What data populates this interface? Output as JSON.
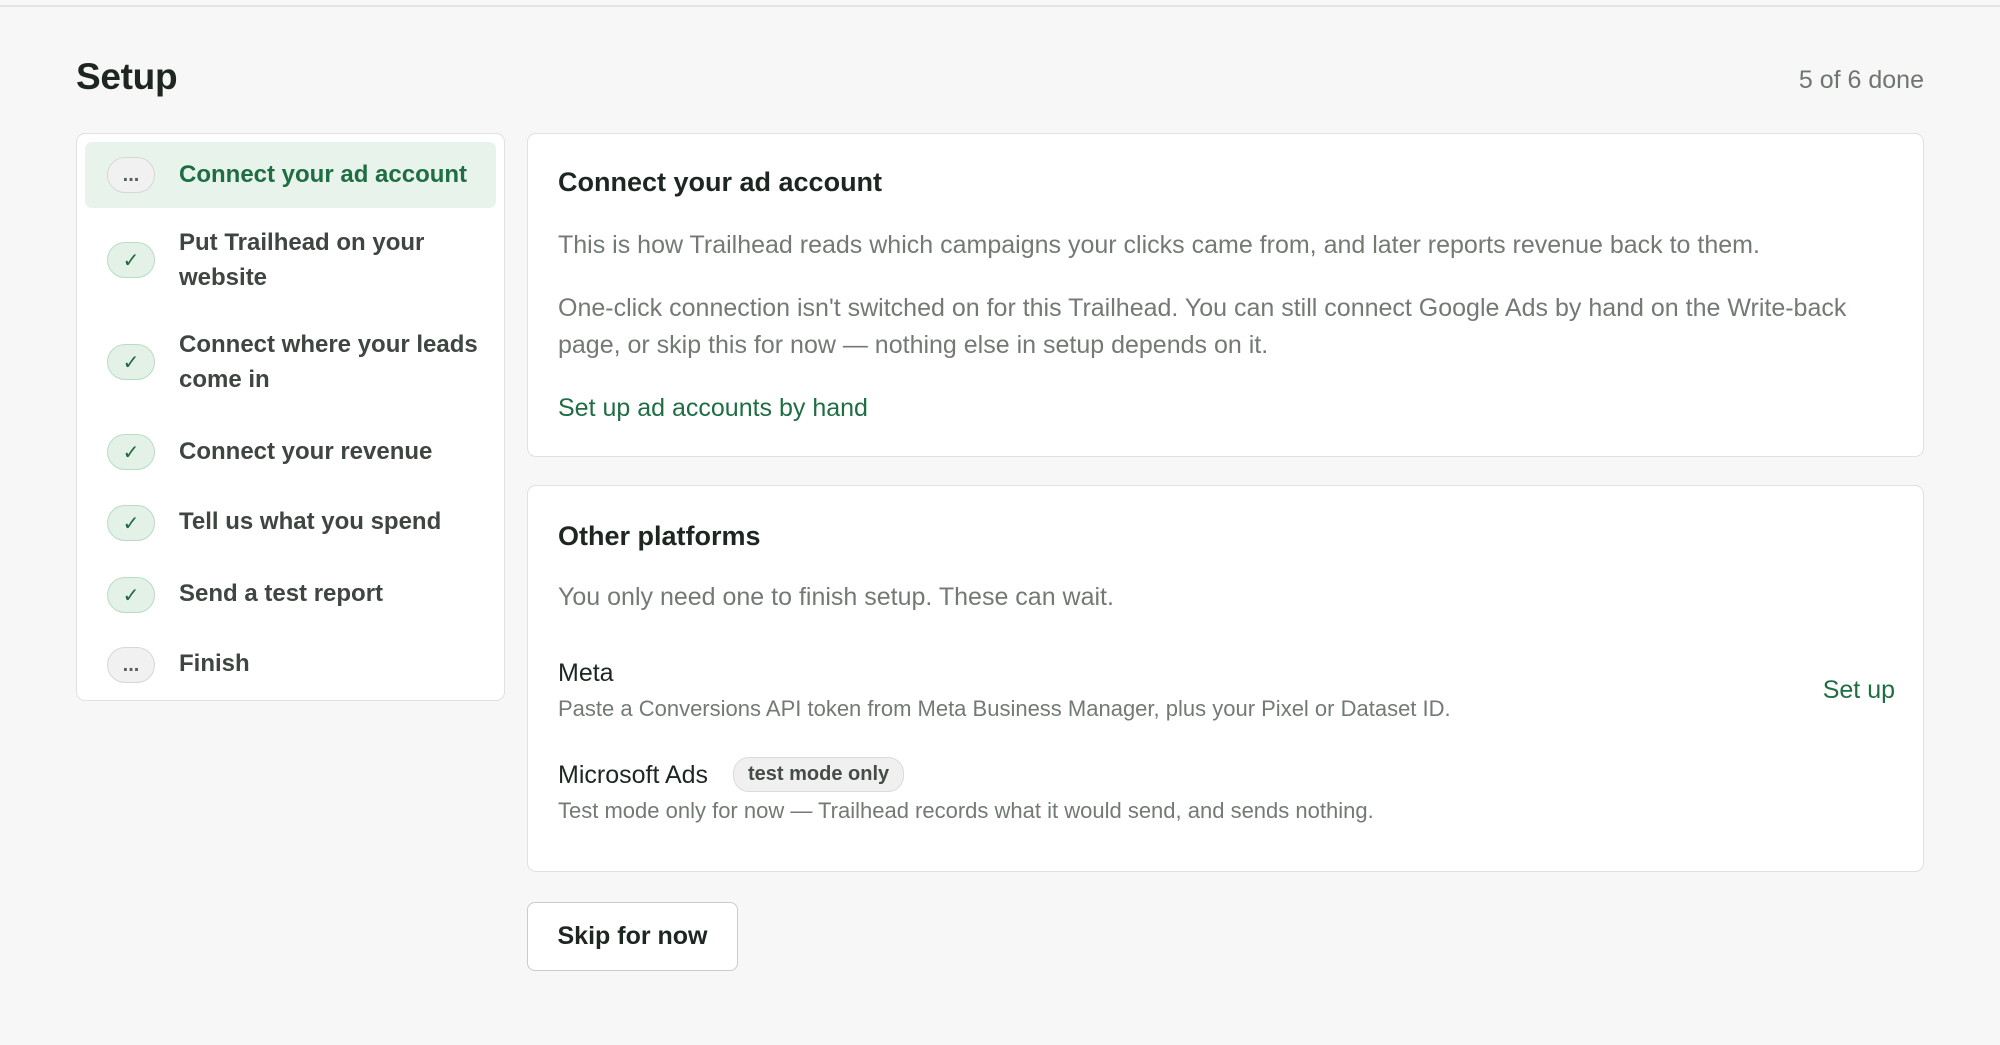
{
  "header": {
    "title": "Setup",
    "progress": "5 of 6 done"
  },
  "steps": [
    {
      "label": "Connect your ad account",
      "status": "current",
      "badge": "..."
    },
    {
      "label": "Put Trailhead on your website",
      "status": "done",
      "badge": "✓"
    },
    {
      "label": "Connect where your leads come in",
      "status": "done",
      "badge": "✓"
    },
    {
      "label": "Connect your revenue",
      "status": "done",
      "badge": "✓"
    },
    {
      "label": "Tell us what you spend",
      "status": "done",
      "badge": "✓"
    },
    {
      "label": "Send a test report",
      "status": "done",
      "badge": "✓"
    },
    {
      "label": "Finish",
      "status": "pending",
      "badge": "..."
    }
  ],
  "ad_account": {
    "title": "Connect your ad account",
    "intro": "This is how Trailhead reads which campaigns your clicks came from, and later reports revenue back to them.",
    "notice": "One-click connection isn't switched on for this Trailhead. You can still connect Google Ads by hand on the Write-back page, or skip this for now — nothing else in setup depends on it.",
    "manual_link": "Set up ad accounts by hand"
  },
  "other_platforms": {
    "title": "Other platforms",
    "subtitle": "You only need one to finish setup. These can wait.",
    "platforms": [
      {
        "name": "Meta",
        "description": "Paste a Conversions API token from Meta Business Manager, plus your Pixel or Dataset ID.",
        "action": "Set up"
      },
      {
        "name": "Microsoft Ads",
        "tag": "test mode only",
        "description": "Test mode only for now — Trailhead records what it would send, and sends nothing."
      }
    ]
  },
  "actions": {
    "skip_label": "Skip for now"
  },
  "colors": {
    "accent": "#1f6e43",
    "active_step_bg": "#e8f3ec",
    "page_bg": "#f7f7f7"
  }
}
